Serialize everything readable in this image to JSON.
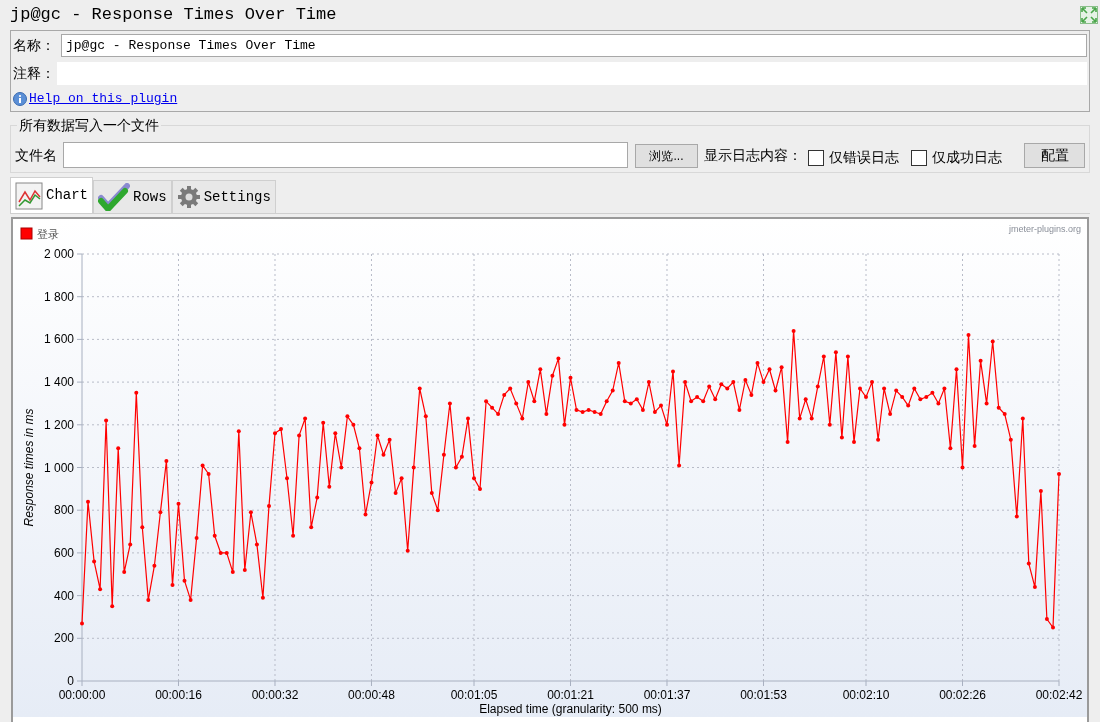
{
  "window": {
    "title": "jp@gc - Response Times Over Time"
  },
  "name_field": {
    "label": "名称：",
    "value": "jp@gc - Response Times Over Time"
  },
  "comment_field": {
    "label": "注释："
  },
  "help_link": "Help on this plugin",
  "file_section": {
    "legend": "所有数据写入一个文件",
    "filename_label": "文件名",
    "browse_button": "浏览...",
    "log_label": "显示日志内容：",
    "checkboxes": [
      {
        "label": "仅错误日志",
        "checked": false
      },
      {
        "label": "仅成功日志",
        "checked": false
      }
    ],
    "config_button": "配置"
  },
  "tabs": [
    {
      "label": "Chart",
      "selected": true,
      "kind": "chart"
    },
    {
      "label": "Rows",
      "selected": false,
      "kind": "rows"
    },
    {
      "label": "Settings",
      "selected": false,
      "kind": "settings"
    }
  ],
  "chart": {
    "brand": "jmeter-plugins.org",
    "chart_data": {
      "type": "line",
      "xlabel": "Elapsed time (granularity: 500 ms)",
      "ylabel": "Response times in ms",
      "x": [
        0,
        1,
        2,
        3,
        4,
        5,
        6,
        7,
        8,
        9,
        10,
        11,
        12,
        13,
        14,
        15,
        16,
        17,
        18,
        19,
        20,
        21,
        22,
        23,
        24,
        25,
        26,
        27,
        28,
        29,
        30,
        31,
        32,
        33,
        34,
        35,
        36,
        37,
        38,
        39,
        40,
        41,
        42,
        43,
        44,
        45,
        46,
        47,
        48,
        49,
        50,
        51,
        52,
        53,
        54,
        55,
        56,
        57,
        58,
        59,
        60,
        61,
        62,
        63,
        64,
        65,
        66,
        67,
        68,
        69,
        70,
        71,
        72,
        73,
        74,
        75,
        76,
        77,
        78,
        79,
        80,
        81,
        82,
        83,
        84,
        85,
        86,
        87,
        88,
        89,
        90,
        91,
        92,
        93,
        94,
        95,
        96,
        97,
        98,
        99,
        100,
        101,
        102,
        103,
        104,
        105,
        106,
        107,
        108,
        109,
        110,
        111,
        112,
        113,
        114,
        115,
        116,
        117,
        118,
        119,
        120,
        121,
        122,
        123,
        124,
        125,
        126,
        127,
        128,
        129,
        130,
        131,
        132,
        133,
        134,
        135,
        136,
        137,
        138,
        139,
        140,
        141,
        142,
        143,
        144,
        145,
        146,
        147,
        148,
        149,
        150,
        151,
        152,
        153,
        154,
        155,
        156,
        157,
        158,
        159,
        160,
        161,
        162
      ],
      "series": [
        {
          "name": "登录",
          "color": "#ff0000",
          "values": [
            270,
            840,
            560,
            430,
            1220,
            350,
            1090,
            510,
            640,
            1350,
            720,
            380,
            540,
            790,
            1030,
            450,
            830,
            470,
            380,
            670,
            1010,
            970,
            680,
            600,
            600,
            510,
            1170,
            520,
            790,
            640,
            390,
            820,
            1160,
            1180,
            950,
            680,
            1150,
            1230,
            720,
            860,
            1210,
            910,
            1160,
            1000,
            1240,
            1200,
            1090,
            780,
            930,
            1150,
            1060,
            1130,
            880,
            950,
            610,
            1000,
            1370,
            1240,
            880,
            800,
            1060,
            1300,
            1000,
            1050,
            1230,
            950,
            900,
            1310,
            1280,
            1250,
            1340,
            1370,
            1300,
            1230,
            1400,
            1310,
            1460,
            1250,
            1430,
            1510,
            1200,
            1420,
            1270,
            1260,
            1270,
            1260,
            1250,
            1310,
            1360,
            1490,
            1310,
            1300,
            1320,
            1270,
            1400,
            1260,
            1290,
            1200,
            1450,
            1010,
            1400,
            1310,
            1330,
            1310,
            1380,
            1320,
            1390,
            1370,
            1400,
            1270,
            1410,
            1340,
            1490,
            1400,
            1460,
            1360,
            1470,
            1120,
            1640,
            1230,
            1320,
            1230,
            1380,
            1520,
            1200,
            1540,
            1140,
            1520,
            1120,
            1370,
            1330,
            1400,
            1130,
            1370,
            1250,
            1360,
            1330,
            1290,
            1370,
            1320,
            1330,
            1350,
            1300,
            1370,
            1090,
            1460,
            1000,
            1620,
            1100,
            1500,
            1300,
            1590,
            1280,
            1250,
            1130,
            770,
            1230,
            550,
            440,
            890,
            290,
            250,
            970
          ]
        }
      ],
      "xlim": [
        0,
        162
      ],
      "ylim": [
        0,
        2000
      ],
      "grid": true,
      "xticks": [
        {
          "value": 0,
          "label": "00:00:00"
        },
        {
          "value": 16,
          "label": "00:00:16"
        },
        {
          "value": 32,
          "label": "00:00:32"
        },
        {
          "value": 48,
          "label": "00:00:48"
        },
        {
          "value": 65,
          "label": "00:01:05"
        },
        {
          "value": 81,
          "label": "00:01:21"
        },
        {
          "value": 97,
          "label": "00:01:37"
        },
        {
          "value": 113,
          "label": "00:01:53"
        },
        {
          "value": 130,
          "label": "00:02:10"
        },
        {
          "value": 146,
          "label": "00:02:26"
        },
        {
          "value": 162,
          "label": "00:02:42"
        }
      ],
      "yticks": [
        {
          "value": 0,
          "label": "0"
        },
        {
          "value": 200,
          "label": "200"
        },
        {
          "value": 400,
          "label": "400"
        },
        {
          "value": 600,
          "label": "600"
        },
        {
          "value": 800,
          "label": "800"
        },
        {
          "value": 1000,
          "label": "1 000"
        },
        {
          "value": 1200,
          "label": "1 200"
        },
        {
          "value": 1400,
          "label": "1 400"
        },
        {
          "value": 1600,
          "label": "1 600"
        },
        {
          "value": 1800,
          "label": "1 800"
        },
        {
          "value": 2000,
          "label": "2 000"
        }
      ]
    }
  }
}
